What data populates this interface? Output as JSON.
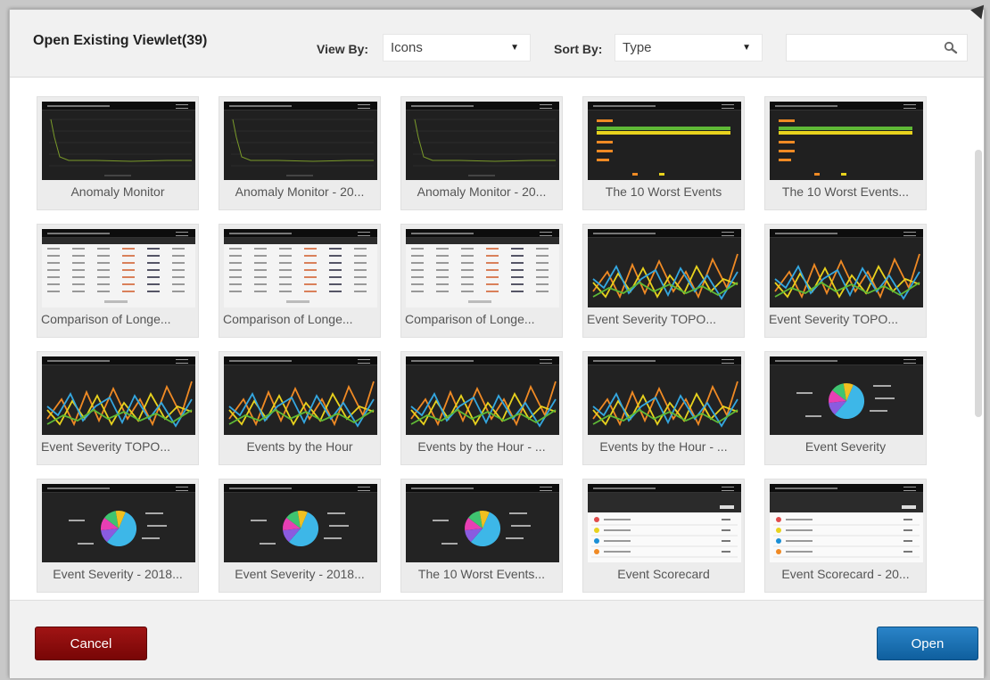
{
  "dialog": {
    "title": "Open Existing Viewlet(39)",
    "view_by_label": "View By:",
    "view_by_value": "Icons",
    "sort_by_label": "Sort By:",
    "sort_by_value": "Type",
    "search_value": ""
  },
  "tiles": [
    {
      "name": "Anomaly Monitor",
      "thumb": "line-flat"
    },
    {
      "name": "Anomaly Monitor - 20...",
      "thumb": "line-flat"
    },
    {
      "name": "Anomaly Monitor - 20...",
      "thumb": "line-flat"
    },
    {
      "name": "The 10 Worst Events",
      "thumb": "bars"
    },
    {
      "name": "The 10 Worst Events...",
      "thumb": "bars"
    },
    {
      "name": "Comparison of Longe...",
      "thumb": "table"
    },
    {
      "name": "Comparison of Longe...",
      "thumb": "table"
    },
    {
      "name": "Comparison of Longe...",
      "thumb": "table"
    },
    {
      "name": "Event Severity TOPO...",
      "thumb": "multiline"
    },
    {
      "name": "Event Severity TOPO...",
      "thumb": "multiline"
    },
    {
      "name": "Event Severity TOPO...",
      "thumb": "multiline"
    },
    {
      "name": "Events by the Hour",
      "thumb": "multiline"
    },
    {
      "name": "Events by the Hour - ...",
      "thumb": "multiline"
    },
    {
      "name": "Events by the Hour - ...",
      "thumb": "multiline"
    },
    {
      "name": "Event Severity",
      "thumb": "pie"
    },
    {
      "name": "Event Severity - 2018...",
      "thumb": "pie"
    },
    {
      "name": "Event Severity - 2018...",
      "thumb": "pie"
    },
    {
      "name": "The 10 Worst Events...",
      "thumb": "pie"
    },
    {
      "name": "Event Scorecard",
      "thumb": "scorecard"
    },
    {
      "name": "Event Scorecard - 20...",
      "thumb": "scorecard"
    }
  ],
  "footer": {
    "cancel_label": "Cancel",
    "open_label": "Open"
  },
  "colors": {
    "cancel": "#8b0d0d",
    "open": "#1a6fb3",
    "series_orange": "#f08a24",
    "series_yellow": "#e8d21d",
    "series_blue": "#34a7e0",
    "series_green": "#5fb936"
  }
}
